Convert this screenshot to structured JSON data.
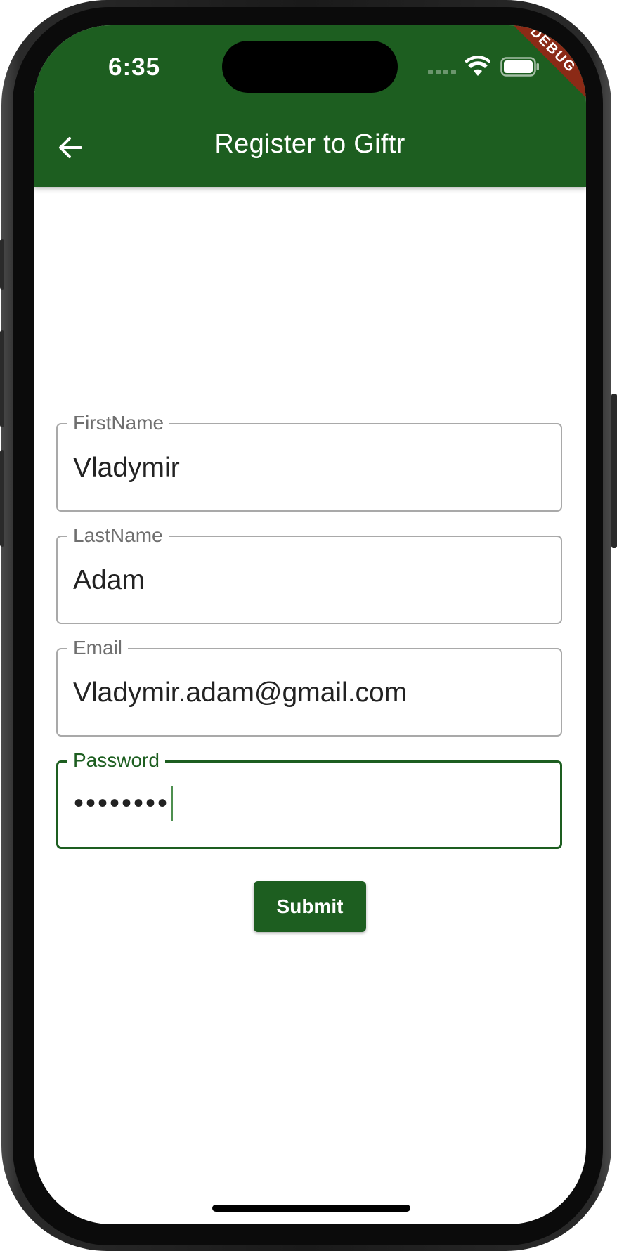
{
  "status_bar": {
    "time": "6:35",
    "debug_banner": "DEBUG"
  },
  "app_bar": {
    "title": "Register to Giftr",
    "back_icon": "arrow-back-icon"
  },
  "form": {
    "first_name": {
      "label": "FirstName",
      "value": "Vladymir"
    },
    "last_name": {
      "label": "LastName",
      "value": "Adam"
    },
    "email": {
      "label": "Email",
      "value": "Vladymir.adam@gmail.com"
    },
    "password": {
      "label": "Password",
      "value": "••••••••"
    },
    "submit_label": "Submit"
  },
  "colors": {
    "primary": "#1d5e20",
    "debug_ribbon": "#8b2a16",
    "field_border": "#a9a9a9"
  }
}
